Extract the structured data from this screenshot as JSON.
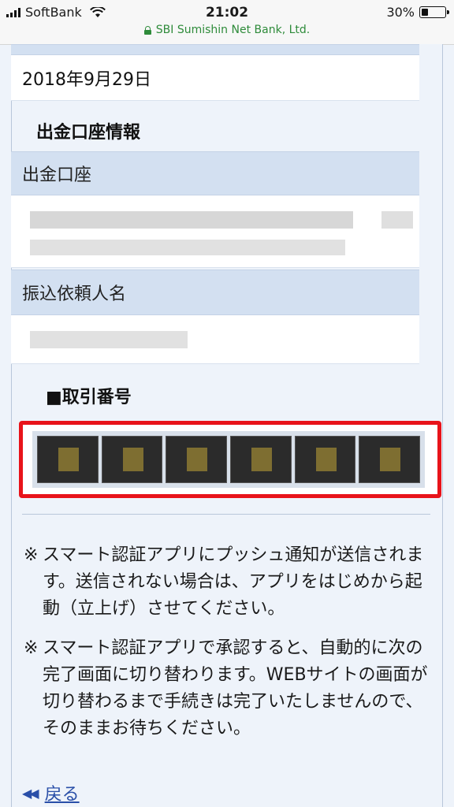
{
  "status_bar": {
    "carrier": "SoftBank",
    "time": "21:02",
    "battery": "30%",
    "url": "SBI Sumishin Net Bank, Ltd."
  },
  "date_value": "2018年9月29日",
  "withdrawal_section": {
    "title": "出金口座情報",
    "account_label": "出金口座",
    "requester_label": "振込依頼人名"
  },
  "transaction": {
    "title": "■取引番号"
  },
  "notes": [
    {
      "mark": "※",
      "text": "スマート認証アプリにプッシュ通知が送信されます。送信されない場合は、アプリをはじめから起動（立上げ）させてください。"
    },
    {
      "mark": "※",
      "text": "スマート認証アプリで承認すると、自動的に次の完了画面に切り替わります。WEBサイトの画面が切り替わるまで手続きは完了いたしませんので、そのままお待ちください。"
    }
  ],
  "back_link": "戻る",
  "icons": {
    "signal": "signal-icon",
    "wifi": "wifi-icon",
    "battery": "battery-icon",
    "lock": "lock-icon",
    "back": "double-chevron-left-icon"
  },
  "colors": {
    "highlight_border": "#e8131a",
    "url_green": "#2e8b3a",
    "row_header_bg": "#d3e0f1",
    "link": "#2a4fa8"
  }
}
